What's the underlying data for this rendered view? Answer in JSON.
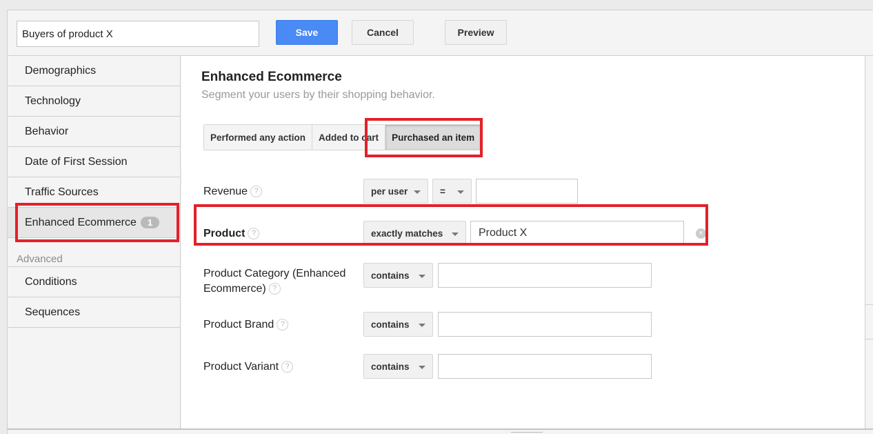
{
  "toolbar": {
    "segment_name": "Buyers of product X",
    "save_label": "Save",
    "cancel_label": "Cancel",
    "preview_label": "Preview"
  },
  "sidebar": {
    "items": [
      {
        "label": "Demographics"
      },
      {
        "label": "Technology"
      },
      {
        "label": "Behavior"
      },
      {
        "label": "Date of First Session"
      },
      {
        "label": "Traffic Sources"
      },
      {
        "label": "Enhanced Ecommerce",
        "badge": "1",
        "active": true
      }
    ],
    "advanced_label": "Advanced",
    "advanced_items": [
      {
        "label": "Conditions"
      },
      {
        "label": "Sequences"
      }
    ]
  },
  "main": {
    "title": "Enhanced Ecommerce",
    "subtitle": "Segment your users by their shopping behavior.",
    "action_tabs": [
      {
        "label": "Performed any action"
      },
      {
        "label": "Added to cart"
      },
      {
        "label": "Purchased an item",
        "selected": true
      }
    ],
    "help_glyph": "?",
    "fields": {
      "revenue": {
        "label": "Revenue",
        "scope": "per user",
        "operator": "=",
        "value": ""
      },
      "product": {
        "label": "Product",
        "operator": "exactly matches",
        "value": "Product X",
        "clear_glyph": "×"
      },
      "product_category": {
        "label": "Product Category (Enhanced Ecommerce)",
        "operator": "contains",
        "value": ""
      },
      "product_brand": {
        "label": "Product Brand",
        "operator": "contains",
        "value": ""
      },
      "product_variant": {
        "label": "Product Variant",
        "operator": "contains",
        "value": ""
      }
    }
  },
  "colors": {
    "accent_blue": "#4a8af4",
    "highlight_red": "#e3202a"
  }
}
